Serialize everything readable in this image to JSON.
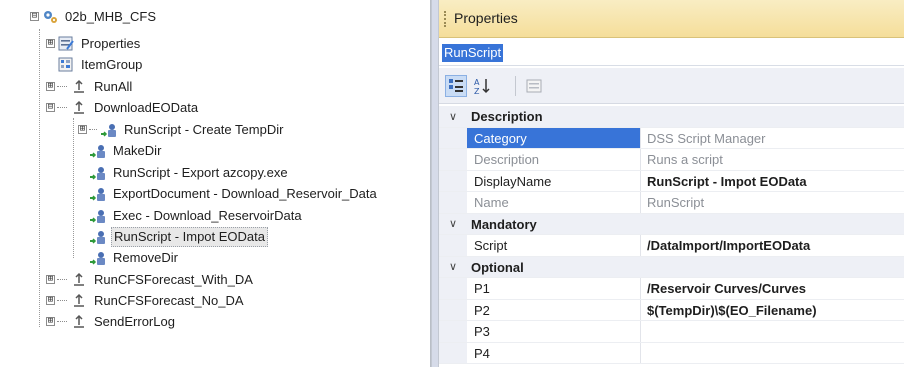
{
  "tree": {
    "root": {
      "label": "02b_MHB_CFS"
    },
    "items": [
      {
        "label": "Properties"
      },
      {
        "label": "ItemGroup"
      },
      {
        "label": "RunAll"
      },
      {
        "label": "DownloadEOData"
      },
      {
        "label": "RunScript - Create TempDir"
      },
      {
        "label": "MakeDir"
      },
      {
        "label": "RunScript - Export azcopy.exe"
      },
      {
        "label": "ExportDocument - Download_Reservoir_Data"
      },
      {
        "label": "Exec - Download_ReservoirData"
      },
      {
        "label": "RunScript - Impot EOData"
      },
      {
        "label": "RemoveDir"
      },
      {
        "label": "RunCFSForecast_With_DA"
      },
      {
        "label": "RunCFSForecast_No_DA"
      },
      {
        "label": "SendErrorLog"
      }
    ],
    "expander_plus": "⊞",
    "expander_minus": "⊟"
  },
  "properties": {
    "title": "Properties",
    "selected_object": "RunScript",
    "categories": [
      {
        "name": "Description",
        "collapse_glyph": "∨",
        "rows": [
          {
            "name": "Category",
            "value": "DSS Script Manager"
          },
          {
            "name": "Description",
            "value": "Runs a script"
          },
          {
            "name": "DisplayName",
            "value": "RunScript - Impot EOData"
          },
          {
            "name": "Name",
            "value": "RunScript"
          }
        ]
      },
      {
        "name": "Mandatory",
        "collapse_glyph": "∨",
        "rows": [
          {
            "name": "Script",
            "value": "/DataImport/ImportEOData"
          }
        ]
      },
      {
        "name": "Optional",
        "collapse_glyph": "∨",
        "rows": [
          {
            "name": "P1",
            "value": "/Reservoir Curves/Curves"
          },
          {
            "name": "P2",
            "value": "$(TempDir)\\$(EO_Filename)"
          },
          {
            "name": "P3",
            "value": ""
          },
          {
            "name": "P4",
            "value": ""
          }
        ]
      }
    ]
  },
  "colors": {
    "selection": "#3874d8",
    "header_gold": "#f5de9a",
    "gutter": "#eef0f6"
  },
  "icons": {
    "root": "gear-tree-icon",
    "properties": "properties-icon",
    "itemgroup": "item-group-icon",
    "task": "task-step-icon",
    "script": "script-node-icon",
    "categorized": "categorized-view-icon",
    "alphabetical": "alphabetical-sort-icon",
    "property_pages": "property-pages-icon"
  }
}
